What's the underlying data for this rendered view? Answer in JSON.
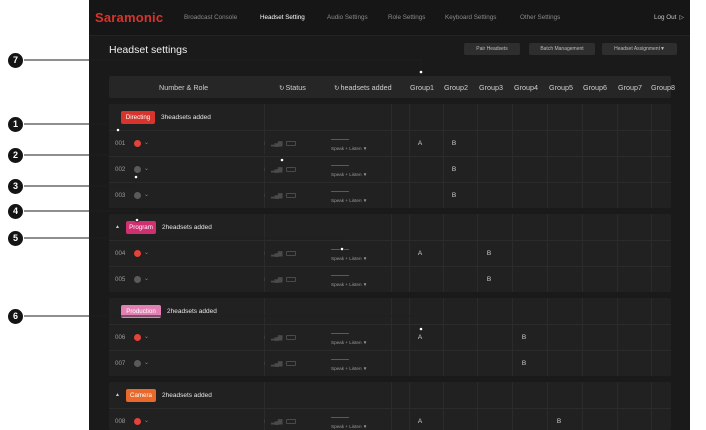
{
  "app": {
    "brand": "Saramonic",
    "nav_tabs": [
      "Broadcast Console",
      "Headset Setting",
      "Audio Settings",
      "Role Settings",
      "Keyboard Settings",
      "Other Settings"
    ],
    "active_tab": "Headset Setting",
    "logout": "Log Out"
  },
  "page": {
    "title": "Headset settings",
    "buttons": {
      "pair": "Pair Headsets",
      "batch": "Batch Management",
      "assignment": "Headset Assignment▼"
    }
  },
  "table": {
    "headers": {
      "number_role": "Number & Role",
      "status": "Status",
      "headsets_added": "headsets added",
      "groups": [
        "Group1",
        "Group2",
        "Group3",
        "Group4",
        "Group5",
        "Group6",
        "Group7",
        "Group8"
      ]
    },
    "sections": [
      {
        "role": "Directing",
        "role_color": "#d8342c",
        "count_text": "3headsets added",
        "rows": [
          {
            "num": "001",
            "dot_color": "#e0443a",
            "mode": "Speak + Listen ▼",
            "groups": {
              "1": "A",
              "2": "B"
            }
          },
          {
            "num": "002",
            "dot_color": "#5a5a5a",
            "mode": "Speak + Listen ▼",
            "groups": {
              "2": "B"
            }
          },
          {
            "num": "003",
            "dot_color": "#5a5a5a",
            "mode": "Speak + Listen ▼",
            "groups": {
              "2": "B"
            }
          }
        ]
      },
      {
        "role": "Program",
        "role_color": "#d02f72",
        "count_text": "2headsets added",
        "rows": [
          {
            "num": "004",
            "dot_color": "#e0443a",
            "mode": "Speak + Listen ▼",
            "groups": {
              "1": "A",
              "3": "B"
            }
          },
          {
            "num": "005",
            "dot_color": "#5a5a5a",
            "mode": "Speak + Listen ▼",
            "groups": {
              "3": "B"
            }
          }
        ]
      },
      {
        "role": "Production",
        "role_color": "#e27fb3",
        "count_text": "2headsets added",
        "rows": [
          {
            "num": "006",
            "dot_color": "#e0443a",
            "mode": "Speak + Listen ▼",
            "groups": {
              "1": "A",
              "4": "B"
            }
          },
          {
            "num": "007",
            "dot_color": "#5a5a5a",
            "mode": "Speak + Listen ▼",
            "groups": {
              "4": "B"
            }
          }
        ]
      },
      {
        "role": "Camera",
        "role_color": "#e8692b",
        "count_text": "2headsets added",
        "rows": [
          {
            "num": "008",
            "dot_color": "#e0443a",
            "mode": "Speak + Listen ▼",
            "groups": {
              "1": "A",
              "5": "B"
            }
          }
        ]
      }
    ]
  },
  "status_icons": {
    "headset": "headset-icon",
    "signal": "signal-icon",
    "battery": "battery-icon"
  },
  "callouts": [
    "1",
    "2",
    "3",
    "4",
    "5",
    "6",
    "7"
  ]
}
